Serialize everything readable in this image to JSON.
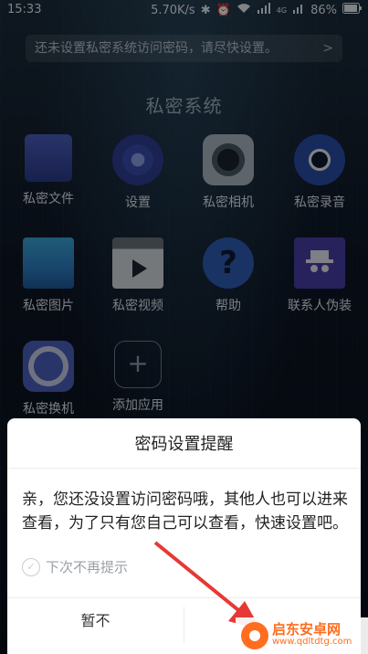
{
  "status_bar": {
    "time": "15:33",
    "speed": "5.70K/s",
    "battery": "86%",
    "network": "4G"
  },
  "notice": {
    "text": "还未设置私密系统访问密码，请尽快设置。",
    "chevron": ">"
  },
  "system_title": "私密系统",
  "apps": [
    {
      "label": "私密文件",
      "icon": "folder-icon"
    },
    {
      "label": "设置",
      "icon": "gear-icon"
    },
    {
      "label": "私密相机",
      "icon": "camera-icon"
    },
    {
      "label": "私密录音",
      "icon": "recorder-icon"
    },
    {
      "label": "私密图片",
      "icon": "image-icon"
    },
    {
      "label": "私密视频",
      "icon": "video-icon"
    },
    {
      "label": "帮助",
      "icon": "help-icon"
    },
    {
      "label": "联系人伪装",
      "icon": "disguise-icon"
    },
    {
      "label": "私密换机",
      "icon": "switch-phone-icon"
    },
    {
      "label": "添加应用",
      "icon": "add-icon"
    }
  ],
  "dialog": {
    "title": "密码设置提醒",
    "message": "亲，您还没设置访问密码哦，其他人也可以进来查看，为了只有您自己可以查看，快速设置吧。",
    "checkbox_label": "下次不再提示",
    "cancel_label": "暂不"
  },
  "watermark": {
    "name": "启东安卓网",
    "url": "www.qdltdtg.com"
  },
  "colors": {
    "annotation_arrow": "#e53935",
    "watermark": "#ff6d1f"
  }
}
